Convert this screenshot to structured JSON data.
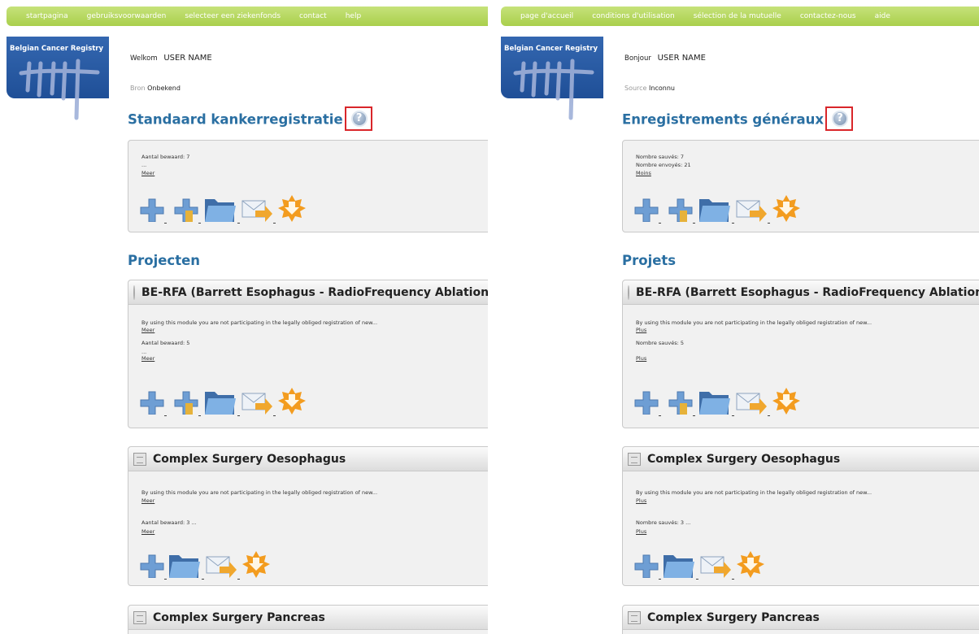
{
  "nl": {
    "nav": [
      "startpagina",
      "gebruiksvoorwaarden",
      "selecteer een ziekenfonds",
      "contact",
      "help"
    ],
    "logo_title": "Belgian Cancer Registry",
    "welcome_label": "Welkom",
    "username": "USER NAME",
    "source_label": "Bron",
    "source_value": "Onbekend",
    "standard_title": "Standaard kankerregistratie",
    "standard_lines": [
      "Aantal bewaard: 7",
      "..."
    ],
    "standard_link": "Meer",
    "projects_title": "Projecten",
    "projects": [
      {
        "title": "BE-RFA (Barrett Esophagus - RadioFrequency Ablation)",
        "desc": "By using this module you are not participating in the legally obliged registration of new...",
        "desc_link": "Meer",
        "count": "Aantal bewaard: 5",
        "dots": "...",
        "count_link": "Meer"
      },
      {
        "title": "Complex Surgery Oesophagus",
        "desc": "By using this module you are not participating in the legally obliged registration of new...",
        "desc_link": "Meer",
        "count": "Aantal bewaard: 3 ...",
        "count_link": "Meer"
      },
      {
        "title": "Complex Surgery Pancreas"
      }
    ]
  },
  "fr": {
    "nav": [
      "page d'accueil",
      "conditions d'utilisation",
      "sélection de la mutuelle",
      "contactez-nous",
      "aide"
    ],
    "logo_title": "Belgian Cancer Registry",
    "welcome_label": "Bonjour",
    "username": "USER NAME",
    "source_label": "Source",
    "source_value": "Inconnu",
    "standard_title": "Enregistrements généraux",
    "standard_lines": [
      "Nombre sauvés: 7",
      "Nombre envoyés: 21"
    ],
    "standard_link": "Moins",
    "projects_title": "Projets",
    "projects": [
      {
        "title": "BE-RFA (Barrett Esophagus - RadioFrequency Ablation)",
        "desc": "By using this module you are not participating in the legally obliged registration of new...",
        "desc_link": "Plus",
        "count": "Nombre sauvés: 5",
        "dots": "",
        "count_link": "Plus"
      },
      {
        "title": "Complex Surgery Oesophagus",
        "desc": "By using this module you are not participating in the legally obliged registration of new...",
        "desc_link": "Plus",
        "count": "Nombre sauvés: 3 ...",
        "count_link": "Plus"
      },
      {
        "title": "Complex Surgery Pancreas"
      }
    ]
  },
  "help_glyph": "?",
  "colors": {
    "nav_green": "#b5d85d",
    "title_blue": "#2a6fa2",
    "help_red": "#d9262a",
    "logo_blue": "#2a5ea8"
  },
  "icons": [
    "add-icon",
    "add-import-icon",
    "folder-icon",
    "send-mail-icon",
    "download-star-icon"
  ]
}
